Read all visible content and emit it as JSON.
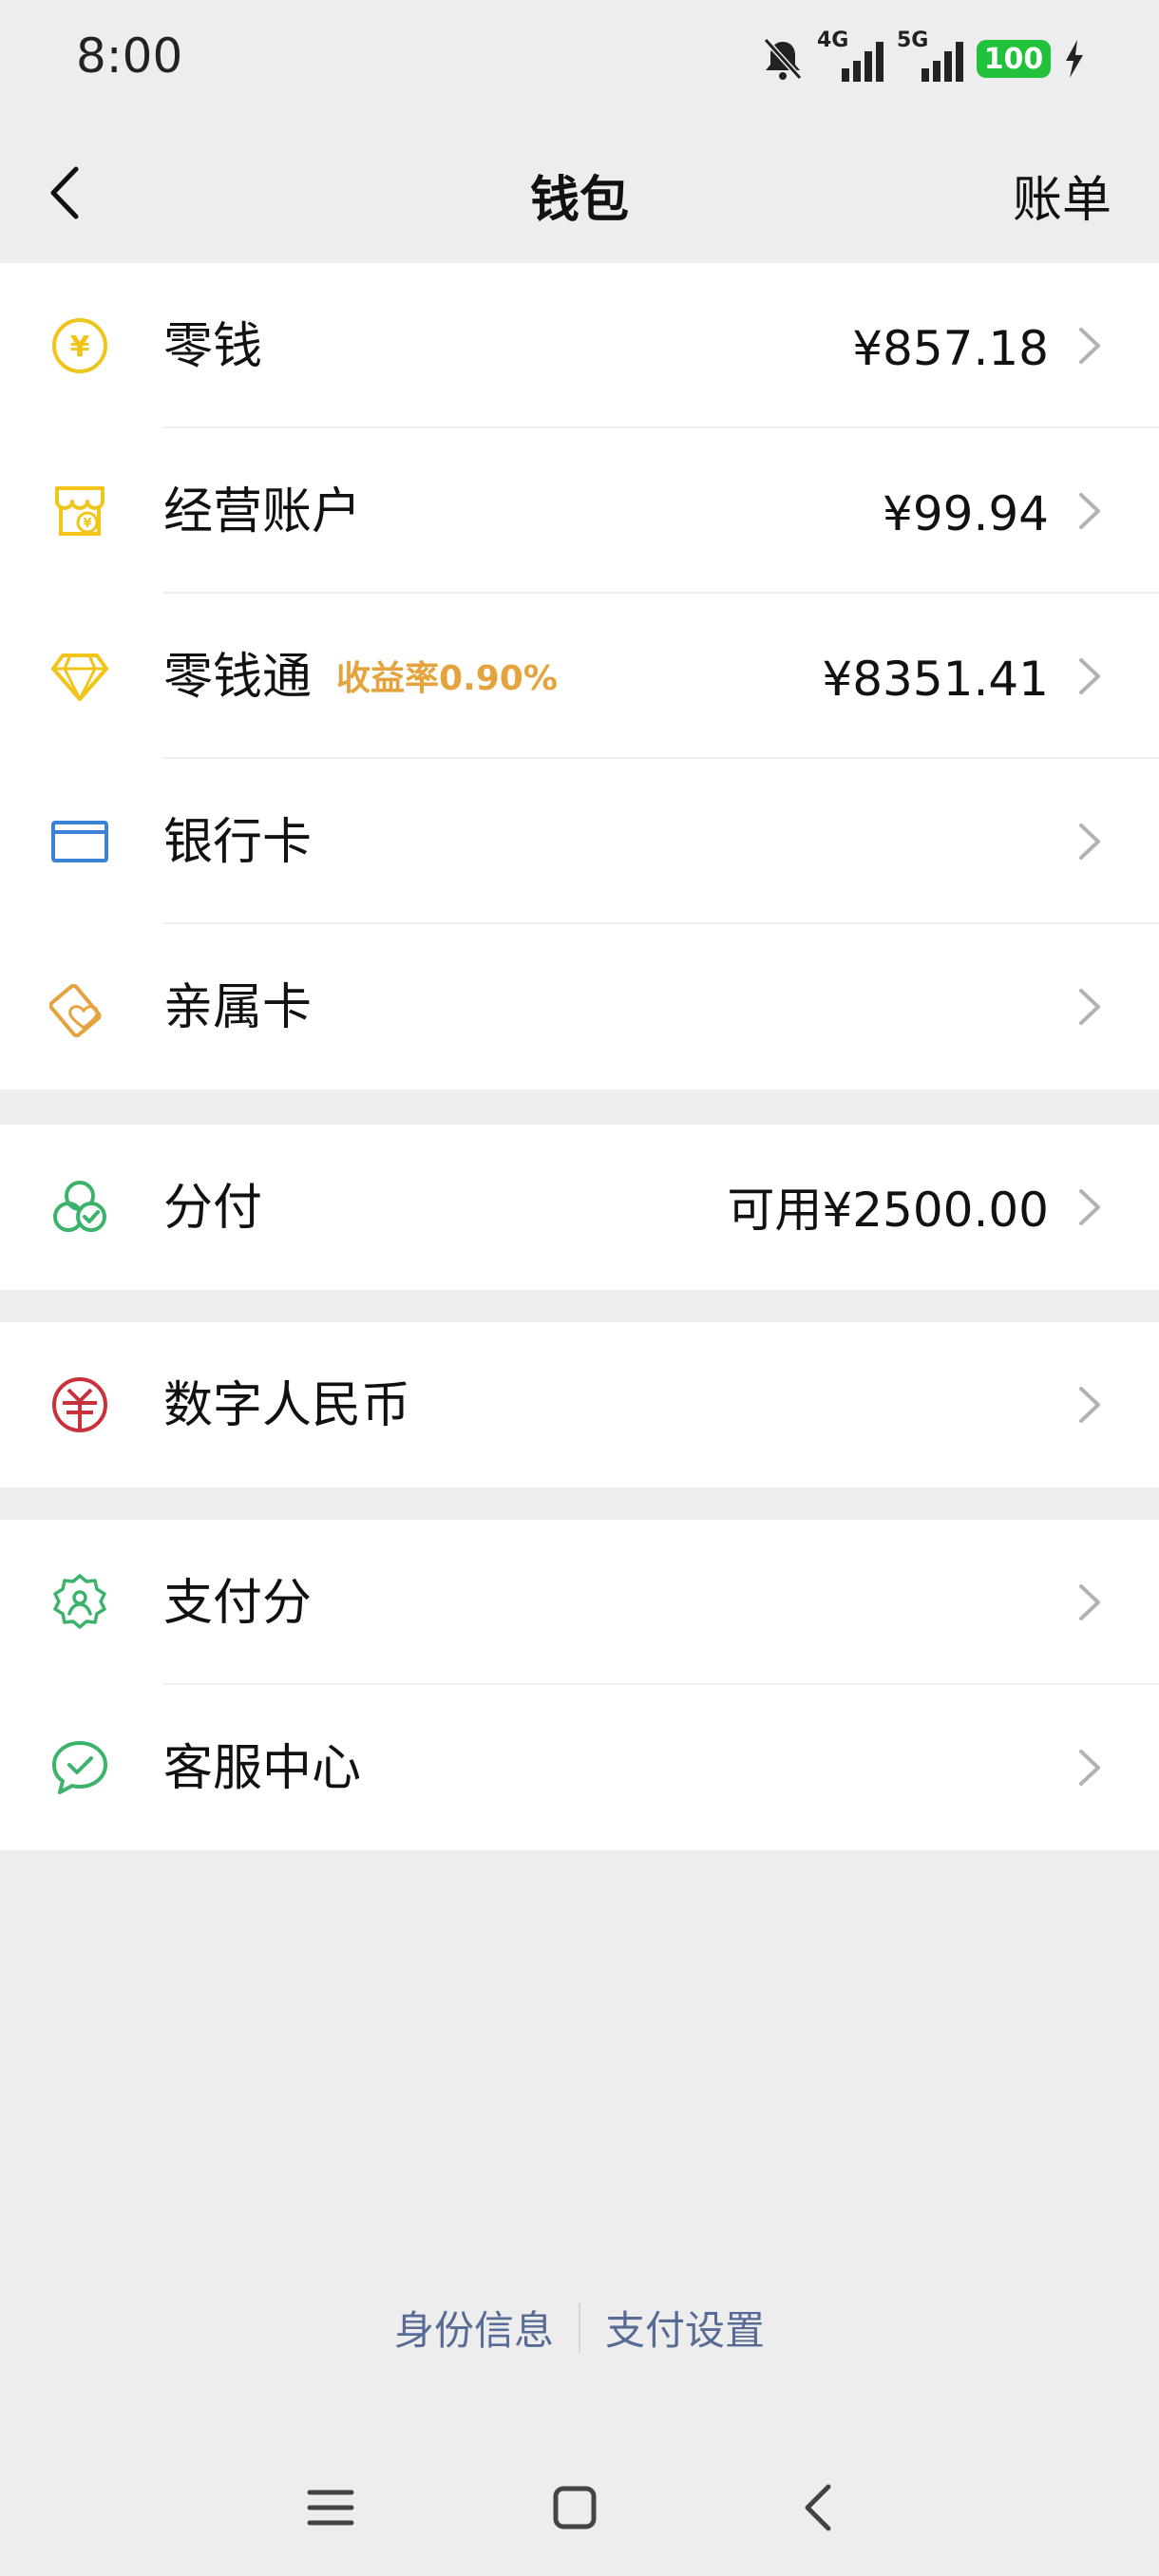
{
  "status": {
    "time": "8:00",
    "net1": "4G",
    "net2": "5G",
    "battery": "100"
  },
  "nav": {
    "title": "钱包",
    "bill": "账单"
  },
  "colors": {
    "accent_gold": "#e4a33d",
    "link_blue": "#576b95",
    "battery_green": "#22c13b"
  },
  "groups": [
    {
      "rows": [
        {
          "icon": "yuan-coin-icon",
          "label": "零钱",
          "value": "¥857.18"
        },
        {
          "icon": "shop-account-icon",
          "label": "经营账户",
          "value": "¥99.94"
        },
        {
          "icon": "diamond-icon",
          "label": "零钱通",
          "tag": "收益率0.90%",
          "value": "¥8351.41"
        },
        {
          "icon": "bank-card-icon",
          "label": "银行卡"
        },
        {
          "icon": "family-card-icon",
          "label": "亲属卡"
        }
      ]
    },
    {
      "rows": [
        {
          "icon": "fenfu-icon",
          "label": "分付",
          "value": "可用¥2500.00"
        }
      ]
    },
    {
      "rows": [
        {
          "icon": "digital-rmb-icon",
          "label": "数字人民币"
        }
      ]
    },
    {
      "rows": [
        {
          "icon": "pay-score-icon",
          "label": "支付分"
        },
        {
          "icon": "customer-service-icon",
          "label": "客服中心"
        }
      ]
    }
  ],
  "footer": {
    "identity": "身份信息",
    "pay_settings": "支付设置"
  }
}
